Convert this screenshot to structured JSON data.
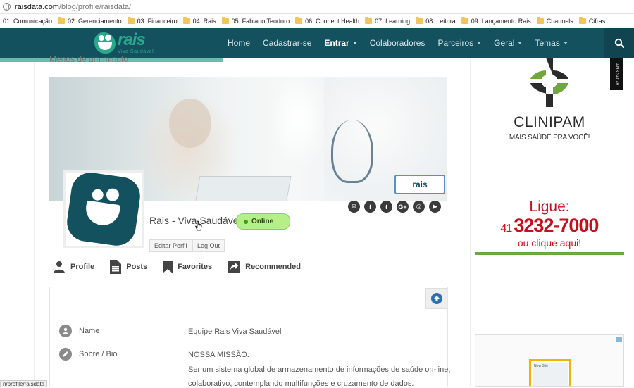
{
  "browser": {
    "url_host": "raisdata.com",
    "url_path": "/blog/profile/raisdata/",
    "status_url": "n/profile/raisdata"
  },
  "bookmarks": [
    {
      "label": "01. Comunicação",
      "folder": false
    },
    {
      "label": "02. Gerenciamento",
      "folder": true
    },
    {
      "label": "03. Financeiro",
      "folder": true
    },
    {
      "label": "04. Rais",
      "folder": true
    },
    {
      "label": "05. Fabiano Teodoro",
      "folder": true
    },
    {
      "label": "06. Connect Health",
      "folder": true
    },
    {
      "label": "07. Learning",
      "folder": true
    },
    {
      "label": "08. Leitura",
      "folder": true
    },
    {
      "label": "09. Lançamento Rais",
      "folder": true
    },
    {
      "label": "Channels",
      "folder": true
    },
    {
      "label": "Cifras",
      "folder": true
    }
  ],
  "logo": {
    "word": "rais",
    "sub": "Viva Saudável"
  },
  "nav": {
    "items": [
      {
        "label": "Home",
        "dropdown": false,
        "active": false
      },
      {
        "label": "Cadastrar-se",
        "dropdown": false,
        "active": false
      },
      {
        "label": "Entrar",
        "dropdown": true,
        "active": true
      },
      {
        "label": "Colaboradores",
        "dropdown": false,
        "active": false
      },
      {
        "label": "Parceiros",
        "dropdown": true,
        "active": false
      },
      {
        "label": "Geral",
        "dropdown": true,
        "active": false
      },
      {
        "label": "Temas",
        "dropdown": true,
        "active": false
      }
    ]
  },
  "reading_time": "Menos de um minuto",
  "cover": {
    "badge_text": "rais"
  },
  "profile": {
    "name": "Rais - Viva Saudável",
    "status": "Online",
    "edit_label": "Editar Perfil",
    "logout_label": "Log Out",
    "socials": [
      {
        "name": "email",
        "glyph": "✉"
      },
      {
        "name": "facebook",
        "glyph": "f"
      },
      {
        "name": "twitter",
        "glyph": "t"
      },
      {
        "name": "google-plus",
        "glyph": "G+"
      },
      {
        "name": "instagram",
        "glyph": "◎"
      },
      {
        "name": "youtube",
        "glyph": "▶"
      }
    ]
  },
  "tabs": [
    {
      "label": "Profile",
      "icon": "user-icon"
    },
    {
      "label": "Posts",
      "icon": "document-icon"
    },
    {
      "label": "Favorites",
      "icon": "bookmark-icon"
    },
    {
      "label": "Recommended",
      "icon": "share-icon"
    }
  ],
  "fields": {
    "name_label": "Name",
    "name_value": "Equipe Rais Viva Saudável",
    "bio_label": "Sobre / Bio",
    "bio_line1": "NOSSA MISSÃO:",
    "bio_line2": "Ser um sistema global de armazenamento de informações de saúde on-line,",
    "bio_line3": "colaborativo, contemplando multifunções e cruzamento de dados."
  },
  "ad_clinipam": {
    "brand": "CLINIPAM",
    "tagline": "MAIS SAÚDE PRA VOCÊ!",
    "ligue": "Ligue:",
    "area": "41",
    "phone": "3232-7000",
    "clique": "ou clique aqui!",
    "ans": "ANS 34078"
  },
  "ad2": {
    "mock_title": "New Site"
  },
  "colors": {
    "navbar": "#14515f",
    "brand_green": "#2aa88c",
    "online_bg": "#b6ef88",
    "ad_red": "#c8101d"
  }
}
